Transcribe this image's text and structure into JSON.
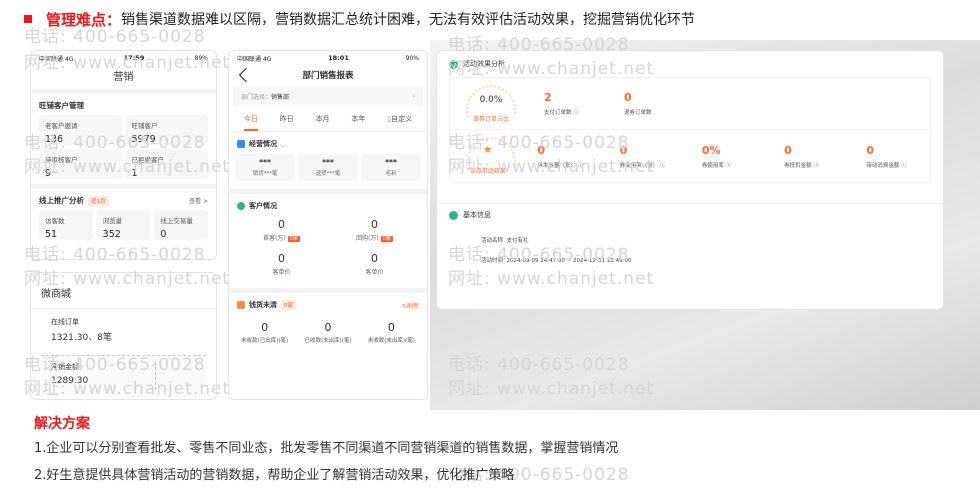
{
  "headline": {
    "label": "管理难点：",
    "text": "销售渠道数据难以区隔，营销数据汇总统计困难，无法有效评估活动效果，挖掘营销优化环节"
  },
  "watermark": {
    "phone": "电话: 400-665-0028",
    "site": "网址: www.chanjet.net"
  },
  "phone1": {
    "status": {
      "carrier": "中国联通 4G",
      "time": "17:59",
      "battery": "89%"
    },
    "title": "营销",
    "shop_section": {
      "title": "旺铺客户管理",
      "cells": [
        {
          "label": "老客户邀请",
          "value": "136"
        },
        {
          "label": "旺铺客户",
          "value": "5979"
        },
        {
          "label": "待审核客户",
          "value": "9"
        },
        {
          "label": "已拒绝客户",
          "value": "1"
        }
      ]
    },
    "promo_section": {
      "title": "线上推广分析",
      "tag": "近1月",
      "more": "查看 >",
      "cells": [
        {
          "label": "访客数",
          "value": "51"
        },
        {
          "label": "浏览量",
          "value": "352"
        },
        {
          "label": "线上交易量",
          "value": "0"
        }
      ]
    }
  },
  "micro_shop": {
    "title": "微商城",
    "order_label": "在线订单",
    "order_value": "1321.30、8笔",
    "net_label": "净销金额",
    "net_value": "1289.30"
  },
  "phone2": {
    "status": {
      "carrier": "中国联通 4G",
      "time": "18:01",
      "battery": "90%"
    },
    "title": "部门销售报表",
    "dept_label": "部门选择：",
    "dept_value": "销售部",
    "tabs": [
      "今日",
      "昨日",
      "本月",
      "本年",
      "自定义"
    ],
    "ops": {
      "title": "经营情况",
      "cells": [
        {
          "value": "***",
          "label": "销货***笔"
        },
        {
          "value": "***",
          "label": "退货***笔"
        },
        {
          "value": "***",
          "label": "毛利"
        }
      ]
    },
    "customer": {
      "title": "客户情况",
      "rows": [
        [
          {
            "value": "0",
            "label": "首客(万)",
            "tag": "0家"
          },
          {
            "value": "0",
            "label": "回购(万)",
            "tag": "0家"
          }
        ],
        [
          {
            "value": "0",
            "label": "客单价"
          },
          {
            "value": "0",
            "label": "客单价"
          }
        ]
      ]
    },
    "goods": {
      "title": "钱货未清",
      "tag": "0家",
      "refresh": "刷新",
      "cells": [
        {
          "value": "0",
          "label": "未收款(已出库)(笔)"
        },
        {
          "value": "0",
          "label": "已收款(未出库)(笔)"
        },
        {
          "value": "0",
          "label": "未收款(未出库)(笔)"
        }
      ]
    }
  },
  "activity": {
    "title": "活动效果分析",
    "row1": {
      "gauge_value": "0.0%",
      "gauge_label": "该券订单占比",
      "metrics": [
        {
          "value": "2",
          "label": "支付订单数"
        },
        {
          "value": "0",
          "label": "退券订单数"
        }
      ]
    },
    "row2": {
      "gauge_label": "该券带动效果",
      "metrics": [
        {
          "value": "0",
          "label": "券发放量（张）"
        },
        {
          "value": "0",
          "label": "券使用量（张）"
        },
        {
          "value": "0%",
          "label": "券使用率"
        },
        {
          "value": "0",
          "label": "券抵扣金额"
        },
        {
          "value": "0",
          "label": "带动消费金额"
        }
      ]
    },
    "info": {
      "title": "基本信息",
      "name_label": "活动名称",
      "name_value": "支付有礼",
      "time_label": "活动时间",
      "time_value": "2024-09-09 14:47:00 ~ 2024-12-31 15:49:00"
    }
  },
  "solution": {
    "title": "解决方案",
    "line1": "1.企业可以分别查看批发、零售不同业态，批发零售不同渠道不同营销渠道的销售数据，掌握营销情况",
    "line2": "2.好生意提供具体营销活动的营销数据，帮助企业了解营销活动效果，优化推广策略"
  }
}
